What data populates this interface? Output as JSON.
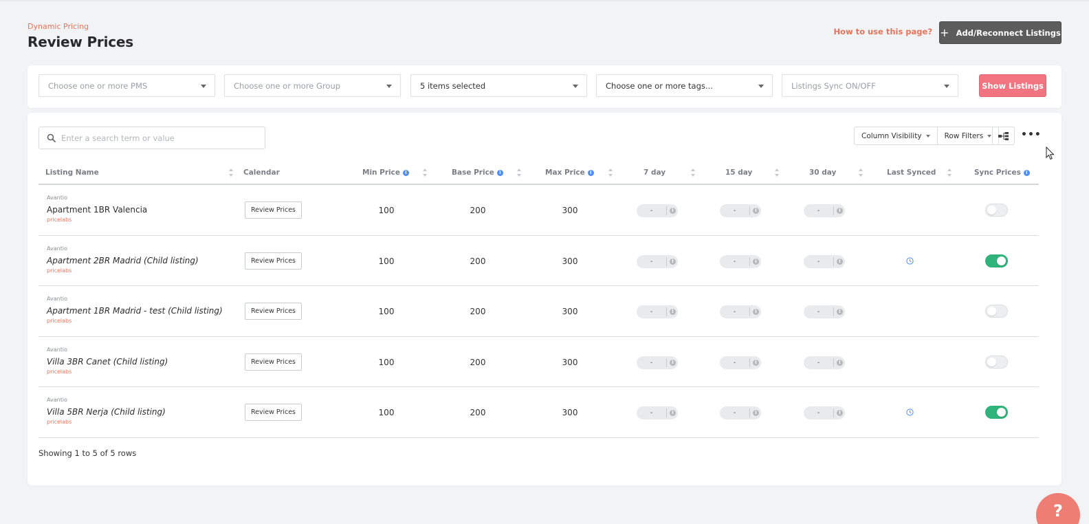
{
  "header": {
    "breadcrumb": "Dynamic Pricing",
    "title": "Review Prices",
    "help_link": "How to use this page?",
    "add_button": "Add/Reconnect Listings"
  },
  "filters": {
    "pms_placeholder": "Choose one or more PMS",
    "group_placeholder": "Choose one or more Group",
    "selected_text": "5 items selected",
    "tags_placeholder": "Choose one or more tags...",
    "sync_placeholder": "Listings Sync ON/OFF",
    "show_button": "Show Listings"
  },
  "toolbar": {
    "search_placeholder": "Enter a search term or value",
    "column_visibility": "Column Visibility",
    "row_filters": "Row Filters",
    "more": "•••"
  },
  "table": {
    "columns": {
      "listing_name": "Listing Name",
      "calendar": "Calendar",
      "min_price": "Min Price",
      "base_price": "Base Price",
      "max_price": "Max Price",
      "d7": "7 day",
      "d15": "15 day",
      "d30": "30 day",
      "last_synced": "Last Synced",
      "sync_prices": "Sync Prices"
    },
    "review_label": "Review Prices",
    "rows": [
      {
        "pms": "Avantio",
        "name": "Apartment 1BR Valencia",
        "source": "pricelabs",
        "min": "100",
        "base": "200",
        "max": "300",
        "d7": "-",
        "d15": "-",
        "d30": "-",
        "synced": false,
        "sync_on": false
      },
      {
        "pms": "Avantio",
        "name": "Apartment 2BR Madrid (Child listing)",
        "source": "pricelabs",
        "min": "100",
        "base": "200",
        "max": "300",
        "d7": "-",
        "d15": "-",
        "d30": "-",
        "synced": true,
        "sync_on": true
      },
      {
        "pms": "Avantio",
        "name": "Apartment 1BR Madrid - test (Child listing)",
        "source": "pricelabs",
        "min": "100",
        "base": "200",
        "max": "300",
        "d7": "-",
        "d15": "-",
        "d30": "-",
        "synced": false,
        "sync_on": false
      },
      {
        "pms": "Avantio",
        "name": "Villa 3BR Canet (Child listing)",
        "source": "pricelabs",
        "min": "100",
        "base": "200",
        "max": "300",
        "d7": "-",
        "d15": "-",
        "d30": "-",
        "synced": false,
        "sync_on": false
      },
      {
        "pms": "Avantio",
        "name": "Villa 5BR Nerja (Child listing)",
        "source": "pricelabs",
        "min": "100",
        "base": "200",
        "max": "300",
        "d7": "-",
        "d15": "-",
        "d30": "-",
        "synced": true,
        "sync_on": true
      }
    ],
    "footer": "Showing 1 to 5 of 5 rows"
  },
  "help_fab": "?",
  "colors": {
    "accent": "#e8735a",
    "show_button": "#f27480",
    "toggle_on": "#2fb37b",
    "add_button": "#5c5c5c"
  }
}
